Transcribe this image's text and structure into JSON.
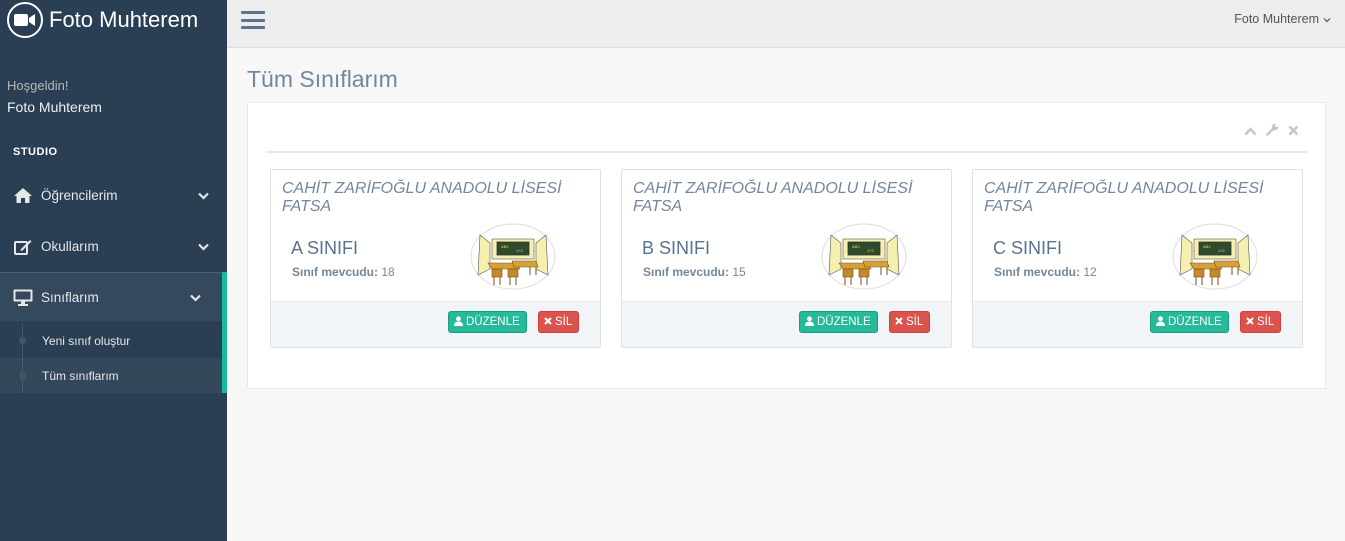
{
  "brand": {
    "name": "Foto Muhterem",
    "icon": "video-camera-icon"
  },
  "welcome": {
    "greeting": "Hoşgeldin!",
    "username": "Foto Muhterem"
  },
  "sidebar": {
    "section_title": "STUDIO",
    "items": [
      {
        "label": "Öğrencilerim",
        "icon": "home-icon"
      },
      {
        "label": "Okullarım",
        "icon": "edit-icon"
      },
      {
        "label": "Sınıflarım",
        "icon": "desktop-icon"
      }
    ],
    "subitems": [
      {
        "label": "Yeni sınıf oluştur"
      },
      {
        "label": "Tüm sınıflarım"
      }
    ]
  },
  "topbar": {
    "user": "Foto Muhterem"
  },
  "page": {
    "title": "Tüm Sınıflarım"
  },
  "cards": [
    {
      "school": "CAHİT ZARİFOĞLU ANADOLU LİSESİ FATSA",
      "class_name": "A SINIFI",
      "count_label": "Sınıf mevcudu:",
      "count": "18",
      "edit": "DÜZENLE",
      "delete": "SİL"
    },
    {
      "school": "CAHİT ZARİFOĞLU ANADOLU LİSESİ FATSA",
      "class_name": "B SINIFI",
      "count_label": "Sınıf mevcudu:",
      "count": "15",
      "edit": "DÜZENLE",
      "delete": "SİL"
    },
    {
      "school": "CAHİT ZARİFOĞLU ANADOLU LİSESİ FATSA",
      "class_name": "C SINIFI",
      "count_label": "Sınıf mevcudu:",
      "count": "12",
      "edit": "DÜZENLE",
      "delete": "SİL"
    }
  ],
  "colors": {
    "sidebar": "#2a3f54",
    "accent": "#1abb9c",
    "edit": "#26b99a",
    "delete": "#d9534f"
  }
}
